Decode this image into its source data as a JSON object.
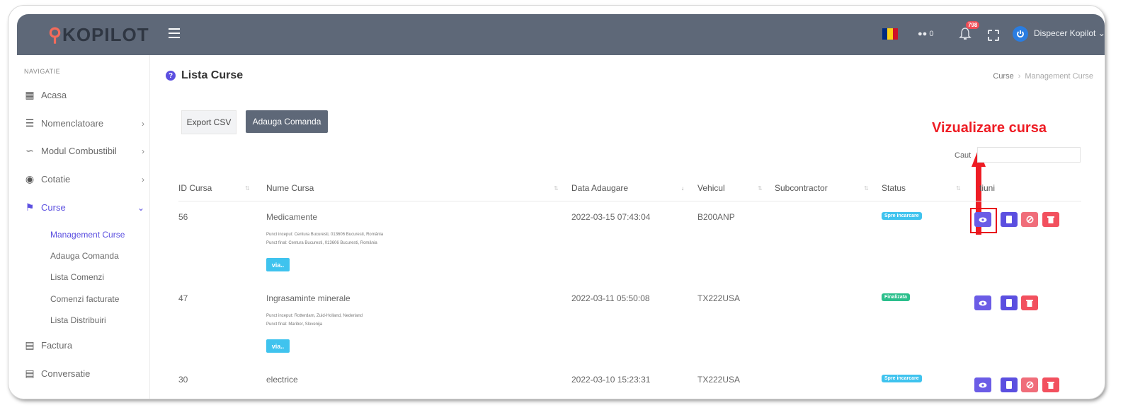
{
  "topbar": {
    "logo_text": "KOPILOT",
    "notif_count": "798",
    "chat_count": "0",
    "user_name": "Dispecer Kopilot"
  },
  "sidebar": {
    "section_title": "NAVIGATIE",
    "items": [
      {
        "label": "Acasa",
        "icon": "dashboard-icon"
      },
      {
        "label": "Nomenclatoare",
        "icon": "list-icon"
      },
      {
        "label": "Modul Combustibil",
        "icon": "route-icon"
      },
      {
        "label": "Cotatie",
        "icon": "globe-icon"
      },
      {
        "label": "Curse",
        "icon": "flag-icon"
      },
      {
        "label": "Factura",
        "icon": "invoice-icon"
      },
      {
        "label": "Conversatie",
        "icon": "chat-icon"
      }
    ],
    "sub_items": [
      "Management Curse",
      "Adauga Comanda",
      "Lista Comenzi",
      "Comenzi facturate",
      "Lista Distribuiri"
    ]
  },
  "page": {
    "title": "Lista Curse",
    "breadcrumb": [
      "Curse",
      "Management Curse"
    ],
    "export_label": "Export CSV",
    "add_label": "Adauga Comanda",
    "search_label": "Caut",
    "annotation": "Vizualizare cursa"
  },
  "table": {
    "headers": [
      "ID Cursa",
      "Nume Cursa",
      "Data Adaugare",
      "Vehicul",
      "Subcontractor",
      "Status",
      "tiuni"
    ],
    "rows": [
      {
        "id": "56",
        "name": "Medicamente",
        "start": "Punct inceput: Centura Bucuresti, 013606 Bucuresti, România",
        "end": "Punct final: Centura Bucuresti, 013606 Bucuresti, România",
        "via": "via..",
        "date": "2022-03-15 07:43:04",
        "vehicle": "B200ANP",
        "status": "Spre incarcare"
      },
      {
        "id": "47",
        "name": "Ingrasaminte minerale",
        "start": "Punct inceput: Rotterdam, Zuid-Holland, Nederland",
        "end": "Punct final: Maribor, Slovenija",
        "via": "via..",
        "date": "2022-03-11 05:50:08",
        "vehicle": "TX222USA",
        "status": "Finalizata"
      },
      {
        "id": "30",
        "name": "electrice",
        "date": "2022-03-10 15:23:31",
        "vehicle": "TX222USA",
        "status": "Spre incarcare"
      }
    ]
  },
  "colors": {
    "topbar": "#5e6878",
    "accent": "#5b4fe0",
    "status_blue": "#3fc3ee",
    "status_green": "#2bbf8c",
    "annotation_red": "#ee1c24"
  }
}
